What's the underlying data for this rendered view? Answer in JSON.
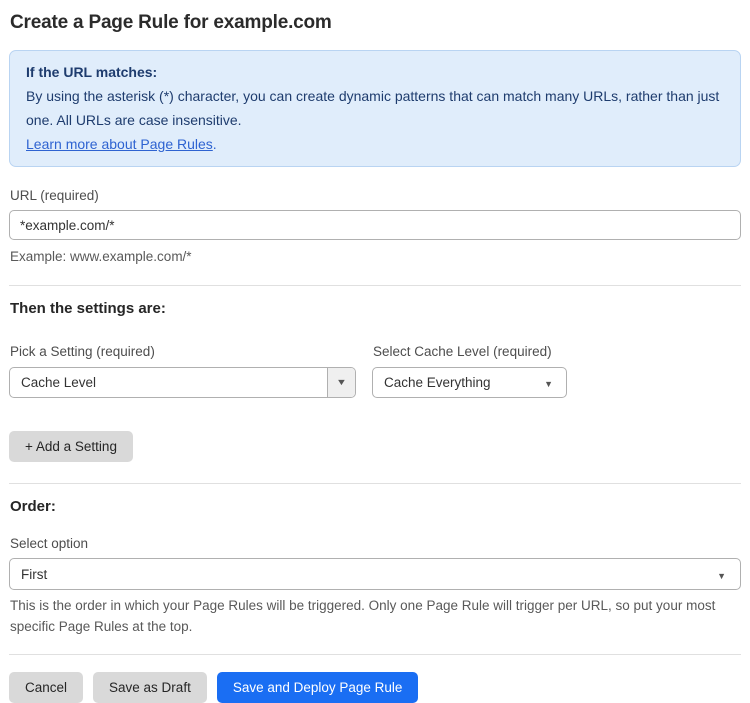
{
  "page": {
    "title": "Create a Page Rule for example.com"
  },
  "info_box": {
    "heading": "If the URL matches:",
    "body": "By using the asterisk (*) character, you can create dynamic patterns that can match many URLs, rather than just one. All URLs are case insensitive.",
    "link_label": "Learn more about Page Rules",
    "link_suffix": "."
  },
  "url_field": {
    "label": "URL (required)",
    "value": "*example.com/*",
    "helper": "Example: www.example.com/*"
  },
  "settings_section": {
    "heading": "Then the settings are:",
    "setting_select": {
      "label": "Pick a Setting (required)",
      "value": "Cache Level"
    },
    "cache_level_select": {
      "label": "Select Cache Level (required)",
      "value": "Cache Everything"
    },
    "add_setting_label": "+ Add a Setting"
  },
  "order_section": {
    "heading": "Order:",
    "label": "Select option",
    "value": "First",
    "helper": "This is the order in which your Page Rules will be triggered. Only one Page Rule will trigger per URL, so put your most specific Page Rules at the top."
  },
  "footer": {
    "cancel_label": "Cancel",
    "save_draft_label": "Save as Draft",
    "save_deploy_label": "Save and Deploy Page Rule"
  },
  "icons": {
    "dropdown_arrow": "▼"
  },
  "colors": {
    "info_box_bg": "#e0edfb",
    "info_box_border": "#b9d4f2",
    "info_box_text": "#1e3c6e",
    "link": "#2e63d1",
    "primary_button_bg": "#1a6ef3",
    "secondary_button_bg": "#d9d9d9",
    "divider": "#e0e0e0"
  }
}
